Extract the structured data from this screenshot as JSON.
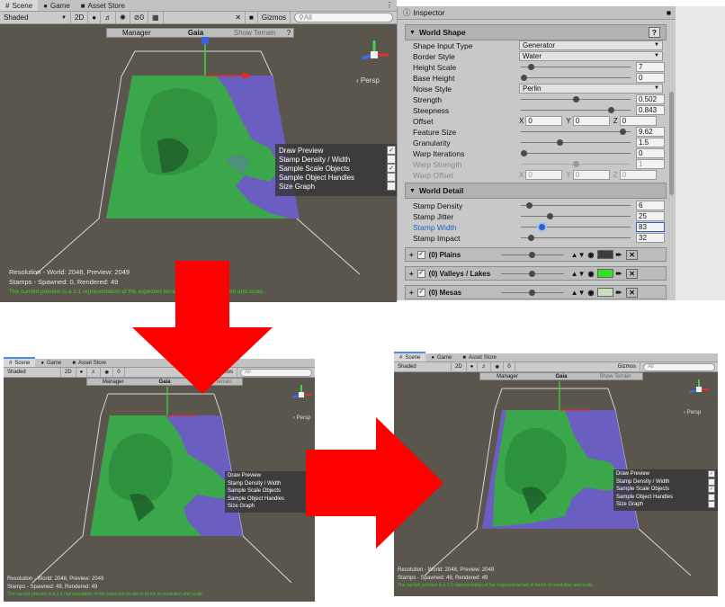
{
  "tabs": [
    {
      "label": "Scene",
      "icon": "scene-icon"
    },
    {
      "label": "Game",
      "icon": "game-icon"
    },
    {
      "label": "Asset Store",
      "icon": "store-icon"
    }
  ],
  "toolbar": {
    "shading_mode": "Shaded",
    "mode_2d": "2D",
    "hidden_count": "0",
    "gizmos_label": "Gizmos",
    "search_placeholder": "All"
  },
  "gaia_bar": {
    "manager": "Manager",
    "title": "Gaia",
    "show_terrain": "Show Terrain"
  },
  "gizmo": {
    "persp_label": "‹ Persp"
  },
  "preview_overlay": {
    "items": [
      {
        "label": "Draw Preview",
        "checked": true
      },
      {
        "label": "Stamp Density / Width",
        "checked": false
      },
      {
        "label": "Sample Scale Objects",
        "checked": true
      },
      {
        "label": "Sample Object Handles",
        "checked": false
      },
      {
        "label": "Size Graph",
        "checked": false
      }
    ]
  },
  "status": {
    "resolution": "Resolution - World: 2048, Preview: 2049",
    "resolution_small": "Resolution - World: 2048, Preview: 2049",
    "stamps": "Stamps - Spawned: 0, Rendered: 49",
    "stamps_small": "Stamps - Spawned: 49, Rendered: 49",
    "note": "The current preview is a 1:1 representation of the expected terrain in terms of resolution and scale."
  },
  "inspector": {
    "tab_label": "Inspector",
    "world_shape": {
      "title": "World Shape",
      "shape_input_type": {
        "label": "Shape Input Type",
        "value": "Generator"
      },
      "border_style": {
        "label": "Border Style",
        "value": "Water"
      },
      "height_scale": {
        "label": "Height Scale",
        "value": "7",
        "fraction": 0.07
      },
      "base_height": {
        "label": "Base Height",
        "value": "0",
        "fraction": 0.0
      },
      "noise_style": {
        "label": "Noise Style",
        "value": "Perlin"
      },
      "strength": {
        "label": "Strength",
        "value": "0.502",
        "fraction": 0.5
      },
      "steepness": {
        "label": "Steepness",
        "value": "0.843",
        "fraction": 0.84
      },
      "offset": {
        "label": "Offset",
        "x": "0",
        "y": "0",
        "z": "0"
      },
      "feature_size": {
        "label": "Feature Size",
        "value": "9.62",
        "fraction": 0.96
      },
      "granularity": {
        "label": "Granularity",
        "value": "1.5",
        "fraction": 0.35
      },
      "warp_iterations": {
        "label": "Warp Iterations",
        "value": "0",
        "fraction": 0.0
      },
      "warp_strength": {
        "label": "Warp Strength",
        "value": "1",
        "fraction": 0.5
      },
      "warp_offset": {
        "label": "Warp Offset",
        "x": "0",
        "y": "0",
        "z": "0"
      }
    },
    "world_detail": {
      "title": "World Detail",
      "stamp_density": {
        "label": "Stamp Density",
        "value": "6",
        "fraction": 0.05
      },
      "stamp_jitter": {
        "label": "Stamp Jitter",
        "value": "25",
        "fraction": 0.25
      },
      "stamp_width": {
        "label": "Stamp Width",
        "value": "83",
        "fraction": 0.17
      },
      "stamp_impact": {
        "label": "Stamp Impact",
        "value": "32",
        "fraction": 0.07
      }
    },
    "biomes": [
      {
        "label": "(0) Plains",
        "color": "#3d3d3d",
        "fraction": 0.5
      },
      {
        "label": "(0) Valleys / Lakes",
        "color": "#33e02a",
        "fraction": 0.5
      },
      {
        "label": "(0) Mesas",
        "color": "#c8ddb8",
        "fraction": 0.5
      }
    ]
  },
  "colors": {
    "arrow": "#ff0000",
    "terrain_green": "#3aa84a",
    "water": "#6a5fc0",
    "status_green": "#3fcf2a",
    "selected_label": "#2a62c8"
  }
}
